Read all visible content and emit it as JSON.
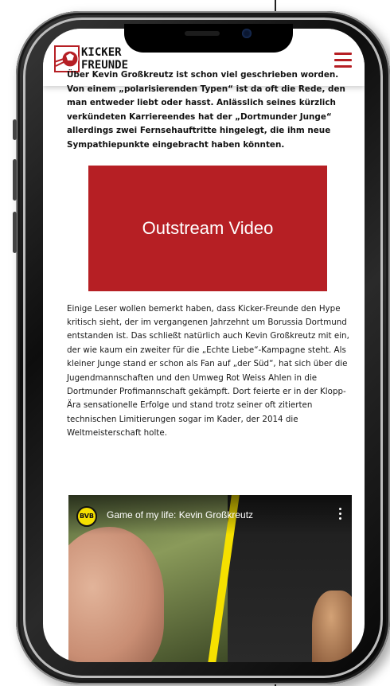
{
  "brand": {
    "name_line1": "KICKER",
    "name_line2": "FREUNDE",
    "accent_color": "#b61f24"
  },
  "header": {
    "menu_icon": "hamburger-menu-icon"
  },
  "article": {
    "intro": "Über Kevin Großkreutz ist schon viel geschrieben worden. Von einem „polarisierenden Typen“ ist da oft die Rede, den man entweder liebt oder hasst. Anlässlich seines kürzlich verkündeten Karriereendes hat der „Dortmunder Junge“ allerdings zwei Fernsehauftritte hingelegt, die ihm neue Sympathiepunkte eingebracht haben könnten.",
    "video_placeholder": "Outstream Video",
    "body": "Einige Leser wollen bemerkt haben, dass Kicker-Freunde den Hype kritisch sieht, der im vergangenen Jahrzehnt um Borussia Dortmund entstanden ist. Das schließt natürlich auch Kevin Großkreutz mit ein, der wie kaum ein zweiter für die „Echte Liebe“-Kampagne steht. Als kleiner Junge stand er schon als Fan auf „der Süd“, hat sich über die Jugendmannschaften und den Umweg Rot Weiss Ahlen in die Dortmunder Profimannschaft gekämpft. Dort feierte er in der Klopp-Ära sensationelle Erfolge und stand trotz seiner oft zitierten technischen Limitierungen sogar im Kader, der 2014 die Weltmeisterschaft holte."
  },
  "youtube": {
    "channel_badge": "BVB",
    "title": "Game of my life: Kevin Großkreutz",
    "more_icon": "more-vertical-icon"
  }
}
